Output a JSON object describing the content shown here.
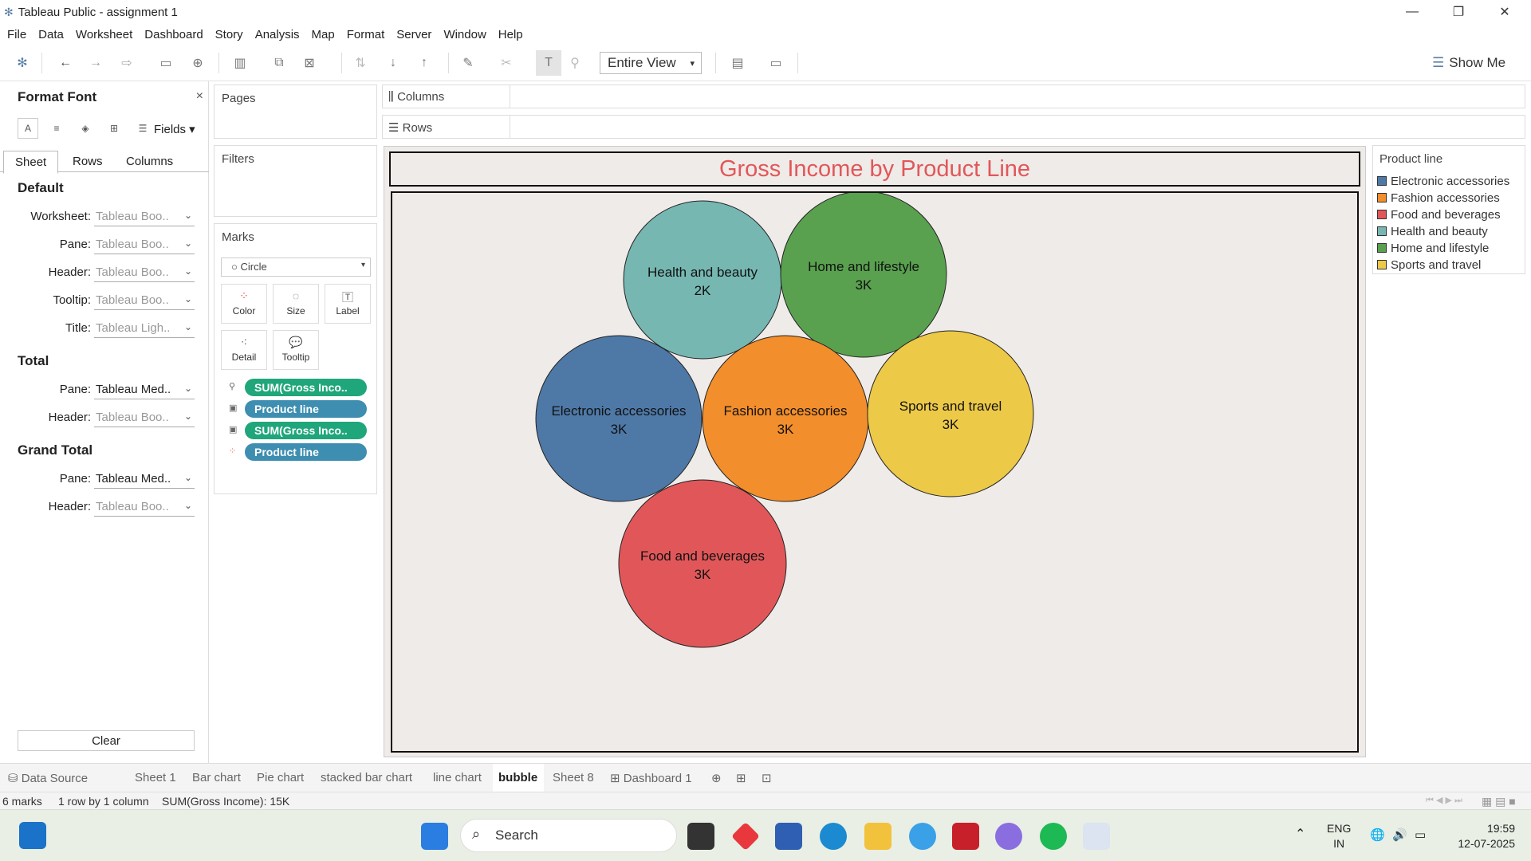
{
  "window": {
    "title": "Tableau Public - assignment 1"
  },
  "menu": [
    "File",
    "Data",
    "Worksheet",
    "Dashboard",
    "Story",
    "Analysis",
    "Map",
    "Format",
    "Server",
    "Window",
    "Help"
  ],
  "toolbar": {
    "view_select": "Entire View",
    "show_me": "Show Me"
  },
  "format_pane": {
    "title": "Format Font",
    "close": "×",
    "fields": "Fields ▾",
    "tabs": [
      "Sheet",
      "Rows",
      "Columns"
    ],
    "sections": {
      "default": {
        "label": "Default",
        "rows": [
          {
            "label": "Worksheet:",
            "value": "Tableau Boo.."
          },
          {
            "label": "Pane:",
            "value": "Tableau Boo.."
          },
          {
            "label": "Header:",
            "value": "Tableau Boo.."
          },
          {
            "label": "Tooltip:",
            "value": "Tableau Boo.."
          },
          {
            "label": "Title:",
            "value": "Tableau Ligh.."
          }
        ]
      },
      "total": {
        "label": "Total",
        "rows": [
          {
            "label": "Pane:",
            "value": "Tableau Med.."
          },
          {
            "label": "Header:",
            "value": "Tableau Boo.."
          }
        ]
      },
      "grand_total": {
        "label": "Grand Total",
        "rows": [
          {
            "label": "Pane:",
            "value": "Tableau Med.."
          },
          {
            "label": "Header:",
            "value": "Tableau Boo.."
          }
        ]
      }
    },
    "clear": "Clear"
  },
  "cards": {
    "pages": "Pages",
    "filters": "Filters",
    "marks": {
      "title": "Marks",
      "type": "Circle",
      "buttons": [
        "Color",
        "Size",
        "Label",
        "Detail",
        "Tooltip"
      ],
      "pills": [
        "SUM(Gross Inco..",
        "Product line",
        "SUM(Gross Inco..",
        "Product line"
      ]
    }
  },
  "shelves": {
    "columns": "Columns",
    "rows": "Rows"
  },
  "chart_data": {
    "type": "bubble",
    "title": "Gross Income by Product Line",
    "measure": "SUM(Gross Income)",
    "bubbles": [
      {
        "name": "Health and beauty",
        "label": "2K",
        "color": "#76b7b2"
      },
      {
        "name": "Home and lifestyle",
        "label": "3K",
        "color": "#59a14f"
      },
      {
        "name": "Electronic accessories",
        "label": "3K",
        "color": "#4e79a7"
      },
      {
        "name": "Fashion accessories",
        "label": "3K",
        "color": "#f28e2b"
      },
      {
        "name": "Sports and travel",
        "label": "3K",
        "color": "#edc948"
      },
      {
        "name": "Food and beverages",
        "label": "3K",
        "color": "#e15759"
      }
    ],
    "legend": {
      "title": "Product line",
      "placement": "right",
      "items": [
        {
          "name": "Electronic accessories",
          "color": "#4e79a7"
        },
        {
          "name": "Fashion accessories",
          "color": "#f28e2b"
        },
        {
          "name": "Food and beverages",
          "color": "#e15759"
        },
        {
          "name": "Health and beauty",
          "color": "#76b7b2"
        },
        {
          "name": "Home and lifestyle",
          "color": "#59a14f"
        },
        {
          "name": "Sports and travel",
          "color": "#edc948"
        }
      ]
    }
  },
  "sheet_tabs": [
    "Data Source",
    "Sheet 1",
    "Bar chart",
    "Pie chart",
    "stacked bar chart",
    "line chart",
    "bubble",
    "Sheet 8",
    "Dashboard 1"
  ],
  "active_tab": "bubble",
  "status": {
    "marks": "6 marks",
    "layout": "1 row by 1 column",
    "sum": "SUM(Gross Income): 15K"
  },
  "taskbar": {
    "search": "Search",
    "lang1": "ENG",
    "lang2": "IN",
    "time": "19:59",
    "date": "12-07-2025"
  }
}
